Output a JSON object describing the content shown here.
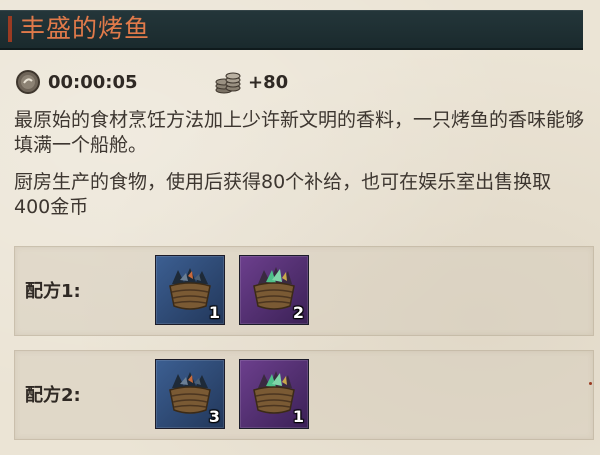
{
  "title": "丰盛的烤鱼",
  "stats": {
    "time_icon": "coin-clock-icon",
    "time": "00:00:05",
    "supply_icon": "coin-stack-icon",
    "supply": "+80"
  },
  "description": [
    "最原始的食材烹饪方法加上少许新文明的香料，一只烤鱼的香味能够填满一个船舱。",
    "厨房生产的食物，使用后获得80个补给，也可在娱乐室出售换取400金币"
  ],
  "recipes": [
    {
      "label": "配方1:",
      "items": [
        {
          "icon": "fish-basket-icon",
          "rarity": "blue",
          "count": "1"
        },
        {
          "icon": "spice-basket-icon",
          "rarity": "purple",
          "count": "2"
        }
      ]
    },
    {
      "label": "配方2:",
      "items": [
        {
          "icon": "fish-basket-icon",
          "rarity": "blue",
          "count": "3"
        },
        {
          "icon": "spice-basket-icon",
          "rarity": "purple",
          "count": "1"
        }
      ]
    }
  ],
  "colors": {
    "title_text": "#e07a4a",
    "title_bg": "#1f3033",
    "rarity_blue": "#3c5f92",
    "rarity_purple": "#6c3f8d"
  }
}
